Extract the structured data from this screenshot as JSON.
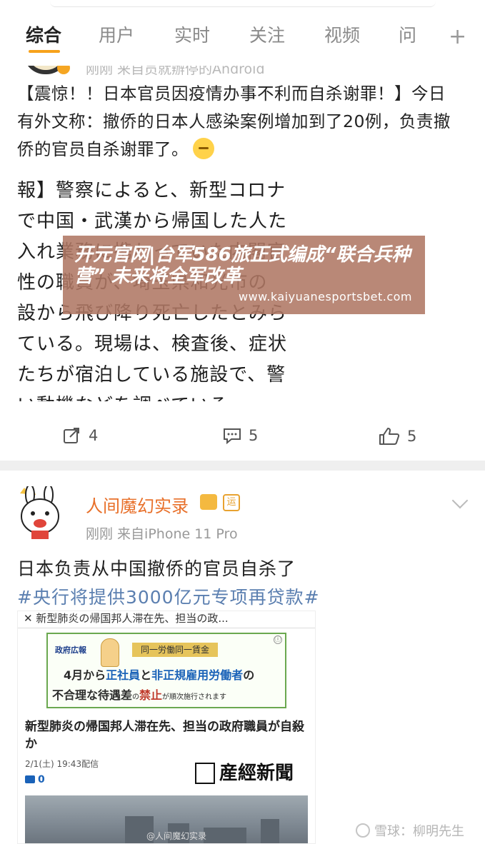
{
  "tabs": [
    {
      "label": "综合",
      "active": true
    },
    {
      "label": "用户",
      "active": false
    },
    {
      "label": "实时",
      "active": false
    },
    {
      "label": "关注",
      "active": false
    },
    {
      "label": "视频",
      "active": false
    },
    {
      "label": "问",
      "active": false
    }
  ],
  "post1": {
    "meta_clipped": "刚刚  来自员就辦停的Android",
    "text_cn": "【震惊！！日本官员因疫情办事不利而自杀谢罪！】今日有外文称：撤侨的日本人感染案例增加到了20例，负责撤侨的官员自杀谢罪了。",
    "jp_lines": [
      "報】警察によると、新型コロナ",
      "で中国・武漢から帰国した人た",
      "入れ業務に携わっていた内閣官",
      "性の職員が、埼玉県和光市の",
      "設から飛び降り死亡したとみら",
      "ている。現場は、検査後、症状",
      "たちが宿泊している施設で、警",
      "い動機などを調べている。"
    ],
    "repost_count": "4",
    "comment_count": "5",
    "like_count": "5"
  },
  "watermark": {
    "title": "开元官网|台军586旅正式编成“联合兵种营” 未来将全军改革",
    "url": "www.kaiyuanesportsbet.com"
  },
  "post2": {
    "username": "人间魔幻实录",
    "vip_badge": "运",
    "meta": "刚刚  来自iPhone 11 Pro",
    "text": "日本负责从中国撤侨的官员自杀了",
    "hashtag": "#央行将提供3000亿元专项再贷款#",
    "shot": {
      "top_bar": "✕  新型肺炎の帰国邦人滞在先、担当の政...",
      "ad_gov": "政府広報",
      "ad_label": "同一労働同一賃金",
      "ad_line1_a": "4月から",
      "ad_line1_b": "正社員",
      "ad_line1_c": "と",
      "ad_line1_d": "非正規雇用労働者",
      "ad_line1_e": "の",
      "ad_line2_a": "不合理な待遇差",
      "ad_line2_b": "の",
      "ad_line2_c": "禁止",
      "ad_line2_d": "が順次施行されます",
      "ad_info": "ⓘ",
      "headline": "新型肺炎の帰国邦人滞在先、担当の政府職員が自殺か",
      "date": "2/1(土) 19:43配信",
      "comments": "0",
      "publisher": "産經新聞",
      "credit": "@人间魔幻实录"
    }
  },
  "footer": {
    "brand": "雪球：柳明先生"
  }
}
